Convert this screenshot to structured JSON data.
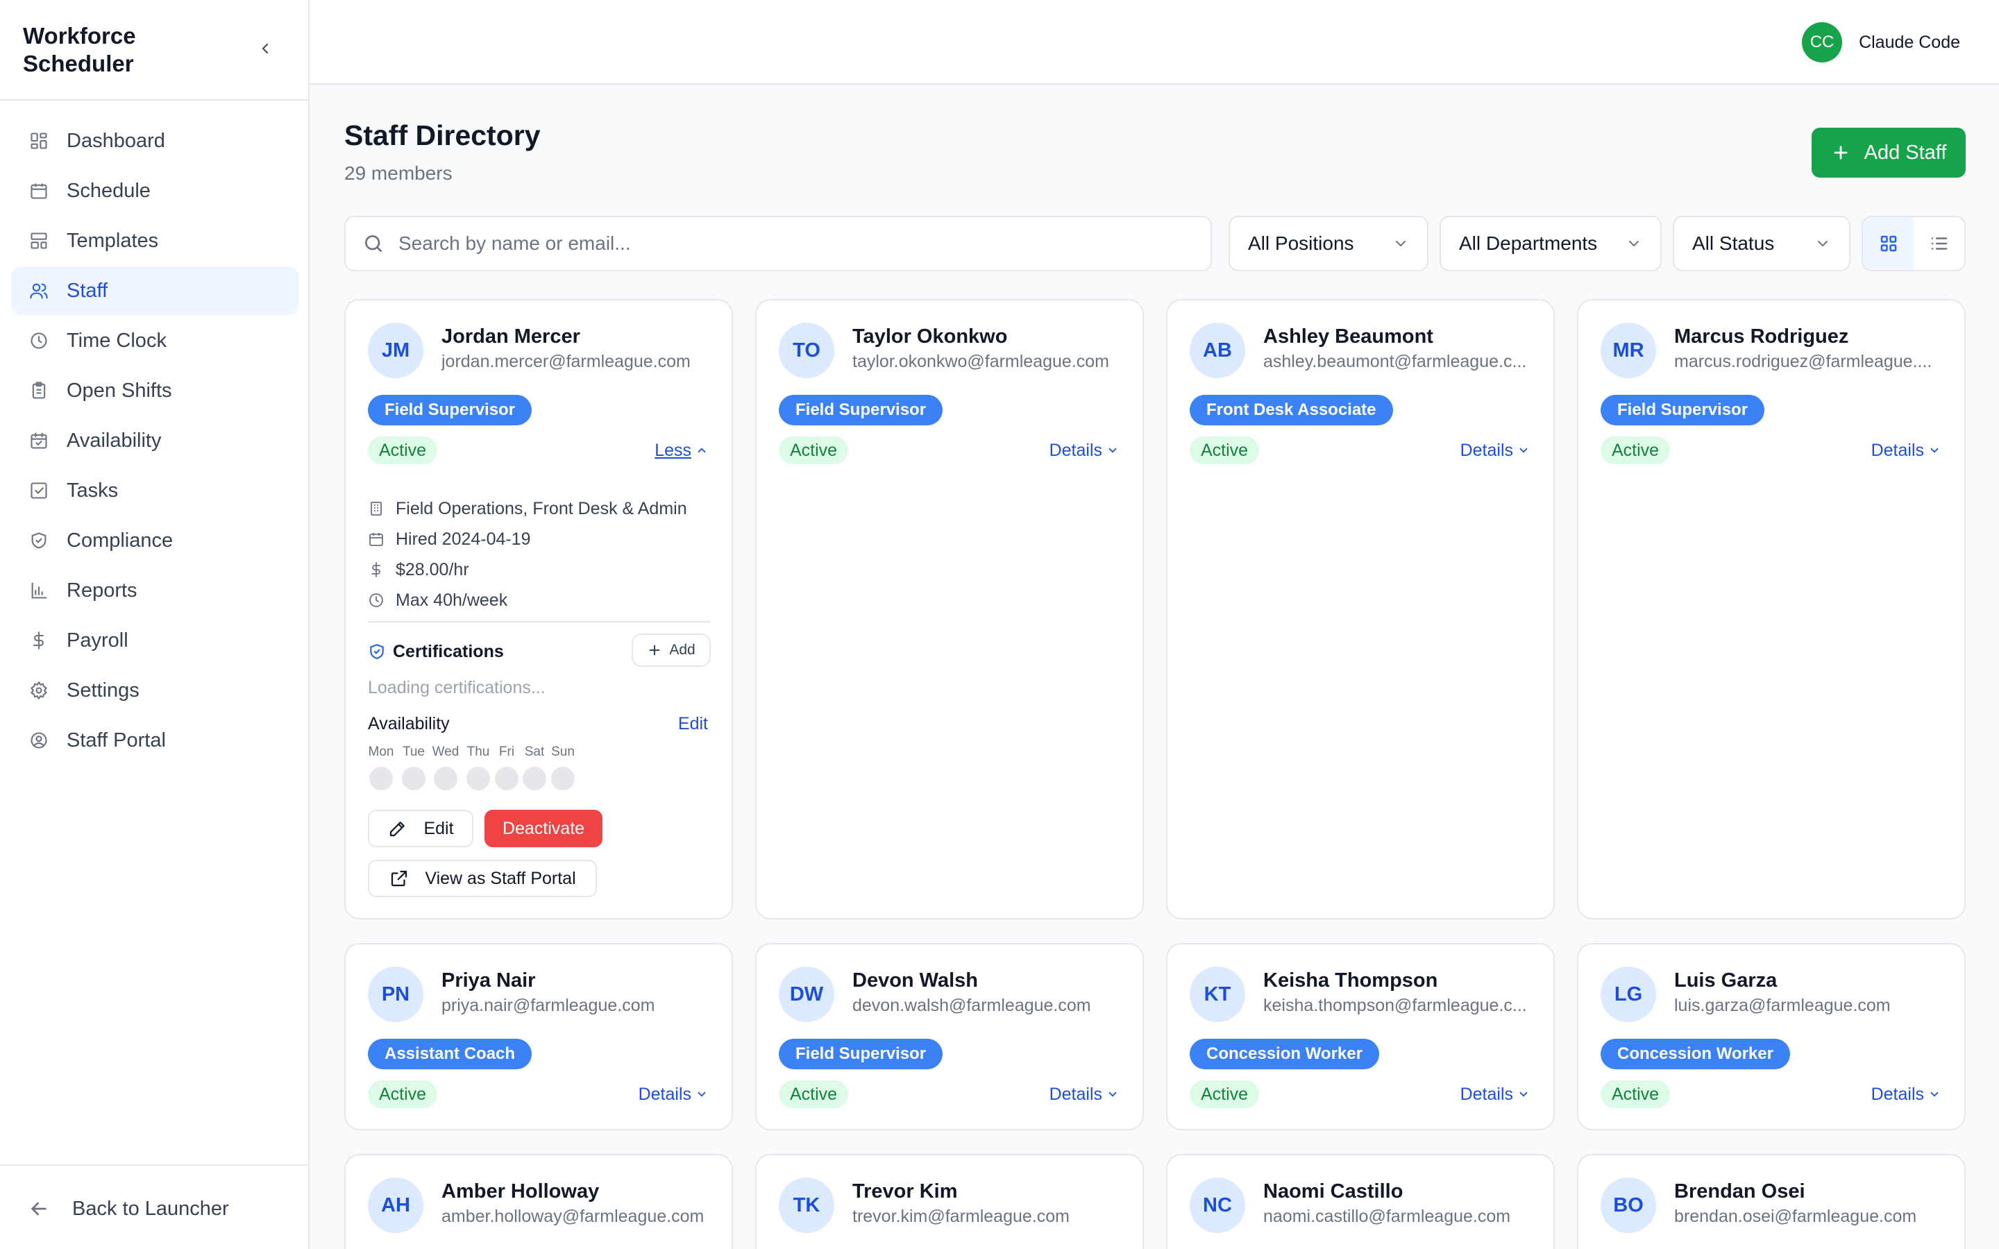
{
  "app": {
    "title": "Workforce Scheduler"
  },
  "sidebar": {
    "items": [
      {
        "label": "Dashboard",
        "icon": "dashboard-icon"
      },
      {
        "label": "Schedule",
        "icon": "calendar-icon"
      },
      {
        "label": "Templates",
        "icon": "templates-icon"
      },
      {
        "label": "Staff",
        "icon": "users-icon",
        "active": true
      },
      {
        "label": "Time Clock",
        "icon": "clock-icon"
      },
      {
        "label": "Open Shifts",
        "icon": "clipboard-icon"
      },
      {
        "label": "Availability",
        "icon": "calendar-check-icon"
      },
      {
        "label": "Tasks",
        "icon": "checkbox-icon"
      },
      {
        "label": "Compliance",
        "icon": "shield-icon"
      },
      {
        "label": "Reports",
        "icon": "bar-chart-icon"
      },
      {
        "label": "Payroll",
        "icon": "dollar-icon"
      },
      {
        "label": "Settings",
        "icon": "gear-icon"
      },
      {
        "label": "Staff Portal",
        "icon": "user-circle-icon"
      }
    ],
    "footer": {
      "back_label": "Back to Launcher"
    }
  },
  "header": {
    "user_initials": "CC",
    "user_name": "Claude Code",
    "avatar_color": "#16a34a"
  },
  "main": {
    "title": "Staff Directory",
    "count_text": "29 members",
    "add_button": "Add Staff",
    "search_placeholder": "Search by name or email...",
    "filters": {
      "positions": "All Positions",
      "departments": "All Departments",
      "status": "All Status"
    },
    "view_mode": "grid"
  },
  "staff": [
    {
      "initials": "JM",
      "name": "Jordan Mercer",
      "email": "jordan.mercer@farmleague.com",
      "role": "Field Supervisor",
      "status": "Active",
      "toggle": "Less",
      "expanded": {
        "departments": "Field Operations, Front Desk & Admin",
        "hired": "Hired 2024-04-19",
        "rate": "$28.00/hr",
        "max_hours": "Max 40h/week",
        "cert_title": "Certifications",
        "cert_add": "Add",
        "cert_loading": "Loading certifications...",
        "avail_title": "Availability",
        "avail_edit": "Edit",
        "days": [
          "Mon",
          "Tue",
          "Wed",
          "Thu",
          "Fri",
          "Sat",
          "Sun"
        ],
        "edit_label": "Edit",
        "deactivate_label": "Deactivate",
        "portal_label": "View as Staff Portal"
      }
    },
    {
      "initials": "TO",
      "name": "Taylor Okonkwo",
      "email": "taylor.okonkwo@farmleague.com",
      "role": "Field Supervisor",
      "status": "Active",
      "toggle": "Details"
    },
    {
      "initials": "AB",
      "name": "Ashley Beaumont",
      "email": "ashley.beaumont@farmleague.c...",
      "role": "Front Desk Associate",
      "status": "Active",
      "toggle": "Details"
    },
    {
      "initials": "MR",
      "name": "Marcus Rodriguez",
      "email": "marcus.rodriguez@farmleague....",
      "role": "Field Supervisor",
      "status": "Active",
      "toggle": "Details"
    },
    {
      "initials": "PN",
      "name": "Priya Nair",
      "email": "priya.nair@farmleague.com",
      "role": "Assistant Coach",
      "status": "Active",
      "toggle": "Details"
    },
    {
      "initials": "DW",
      "name": "Devon Walsh",
      "email": "devon.walsh@farmleague.com",
      "role": "Field Supervisor",
      "status": "Active",
      "toggle": "Details"
    },
    {
      "initials": "KT",
      "name": "Keisha Thompson",
      "email": "keisha.thompson@farmleague.c...",
      "role": "Concession Worker",
      "status": "Active",
      "toggle": "Details"
    },
    {
      "initials": "LG",
      "name": "Luis Garza",
      "email": "luis.garza@farmleague.com",
      "role": "Concession Worker",
      "status": "Active",
      "toggle": "Details"
    },
    {
      "initials": "AH",
      "name": "Amber Holloway",
      "email": "amber.holloway@farmleague.com"
    },
    {
      "initials": "TK",
      "name": "Trevor Kim",
      "email": "trevor.kim@farmleague.com"
    },
    {
      "initials": "NC",
      "name": "Naomi Castillo",
      "email": "naomi.castillo@farmleague.com"
    },
    {
      "initials": "BO",
      "name": "Brendan Osei",
      "email": "brendan.osei@farmleague.com"
    }
  ],
  "colors": {
    "primary": "#2563eb",
    "success": "#16a34a",
    "danger": "#ef4444",
    "role_badge": "#3b82f6",
    "status_bg": "#dcfce7"
  }
}
